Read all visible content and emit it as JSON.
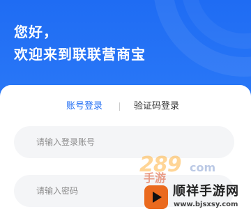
{
  "header": {
    "greeting": "您好，",
    "welcome": "欢迎来到联联营商宝"
  },
  "tabs": [
    {
      "label": "账号登录",
      "active": true
    },
    {
      "label": "验证码登录",
      "active": false
    }
  ],
  "form": {
    "account_placeholder": "请输入登录账号",
    "account_value": "",
    "password_placeholder": "请输入密码",
    "password_value": ""
  },
  "watermark": {
    "number": "289",
    "com": "com",
    "game_label": "手游",
    "brand": "顺祥手游网",
    "url": "www.bjsxsy.com"
  },
  "colors": {
    "accent": "#1f6cf3",
    "header_bg": "#2a78f7",
    "field_bg": "#f4f5f7",
    "logo_bg": "#ea6a1e"
  }
}
